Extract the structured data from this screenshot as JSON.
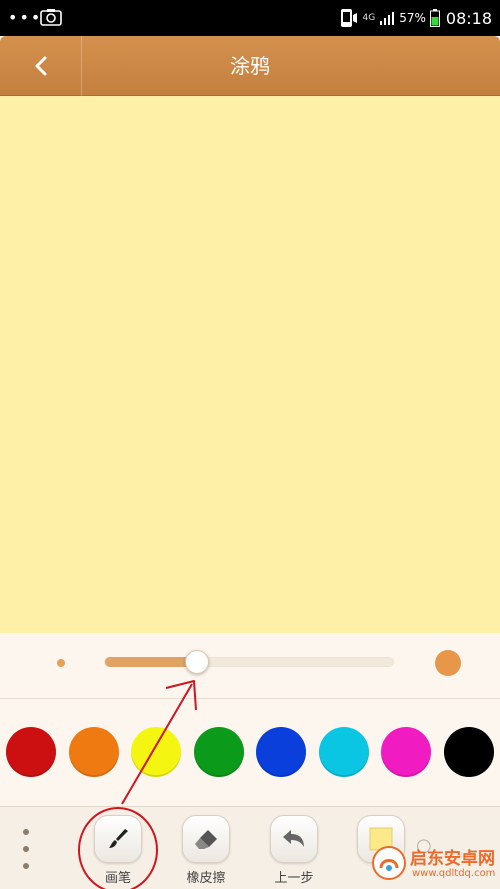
{
  "status_bar": {
    "network": "4G",
    "battery": "57%",
    "time": "08:18"
  },
  "header": {
    "title": "涂鸦",
    "back_icon": "chevron-left-icon"
  },
  "brush_size": {
    "level_fraction": 0.32,
    "min_icon": "small-dot-icon",
    "max_icon": "large-dot-icon"
  },
  "palette": {
    "colors": [
      "#cc1012",
      "#f07a12",
      "#f5f512",
      "#0c9a1a",
      "#0a3fdc",
      "#0ac6e2",
      "#f01cc2",
      "#000000"
    ]
  },
  "toolbar": {
    "more_icon": "more-vertical-icon",
    "tools": [
      {
        "label": "画笔",
        "icon": "brush-icon"
      },
      {
        "label": "橡皮擦",
        "icon": "eraser-icon"
      },
      {
        "label": "上一步",
        "icon": "undo-icon"
      },
      {
        "label": "",
        "icon": "note-icon"
      }
    ]
  },
  "annotations": {
    "color": "#d2141e"
  },
  "watermark": {
    "name": "启东安卓网",
    "url": "www.qdltdq.com"
  }
}
